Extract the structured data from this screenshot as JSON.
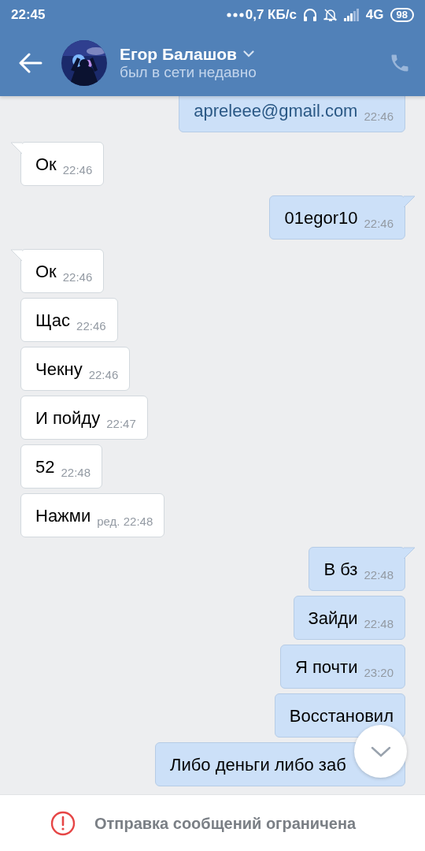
{
  "status_bar": {
    "time": "22:45",
    "network_speed": "0,7 КБ/с",
    "network": "4G",
    "battery": "98"
  },
  "header": {
    "name": "Егор Балашов",
    "status": "был в сети недавно"
  },
  "messages": [
    {
      "outgoing": true,
      "tail": false,
      "text": "apreleee@gmail.com",
      "time": "22:46",
      "link": true
    },
    {
      "outgoing": false,
      "tail": true,
      "text": "Ок",
      "time": "22:46"
    },
    {
      "outgoing": true,
      "tail": true,
      "text": "01egor10",
      "time": "22:46"
    },
    {
      "outgoing": false,
      "tail": true,
      "text": "Ок",
      "time": "22:46"
    },
    {
      "outgoing": false,
      "tail": false,
      "text": "Щас",
      "time": "22:46"
    },
    {
      "outgoing": false,
      "tail": false,
      "text": "Чекну",
      "time": "22:46"
    },
    {
      "outgoing": false,
      "tail": false,
      "text": "И пойду",
      "time": "22:47"
    },
    {
      "outgoing": false,
      "tail": false,
      "text": "52",
      "time": "22:48"
    },
    {
      "outgoing": false,
      "tail": false,
      "text": "Нажми",
      "time": "ред. 22:48"
    },
    {
      "outgoing": true,
      "tail": true,
      "text": "В бз",
      "time": "22:48"
    },
    {
      "outgoing": true,
      "tail": false,
      "text": "Зайди",
      "time": "22:48"
    },
    {
      "outgoing": true,
      "tail": false,
      "text": "Я почти",
      "time": "23:20"
    },
    {
      "outgoing": true,
      "tail": false,
      "text": "Восстановил"
    },
    {
      "outgoing": true,
      "tail": false,
      "text": "Либо деньги либо заб"
    }
  ],
  "notice": {
    "text": "Отправка сообщений ограничена"
  }
}
